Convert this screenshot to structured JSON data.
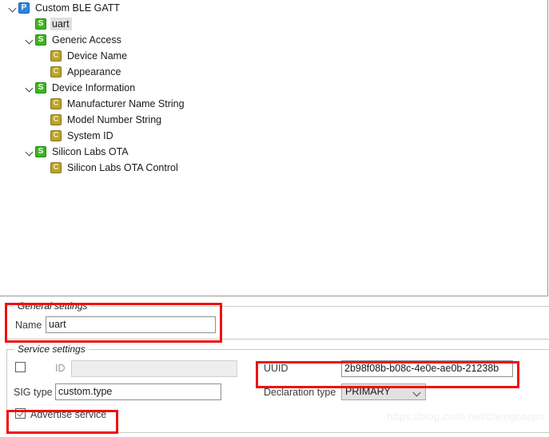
{
  "tree": {
    "name": "gatt-tree",
    "nodes": [
      {
        "label": "Custom BLE GATT",
        "icon": "P",
        "depth": 0,
        "twisty": "open",
        "selected": false
      },
      {
        "label": "uart",
        "icon": "S",
        "depth": 1,
        "twisty": "none",
        "selected": true
      },
      {
        "label": "Generic Access",
        "icon": "S",
        "depth": 1,
        "twisty": "open",
        "selected": false
      },
      {
        "label": "Device Name",
        "icon": "C",
        "depth": 2,
        "twisty": "none",
        "selected": false
      },
      {
        "label": "Appearance",
        "icon": "C",
        "depth": 2,
        "twisty": "none",
        "selected": false
      },
      {
        "label": "Device Information",
        "icon": "S",
        "depth": 1,
        "twisty": "open",
        "selected": false
      },
      {
        "label": "Manufacturer Name String",
        "icon": "C",
        "depth": 2,
        "twisty": "none",
        "selected": false
      },
      {
        "label": "Model Number String",
        "icon": "C",
        "depth": 2,
        "twisty": "none",
        "selected": false
      },
      {
        "label": "System ID",
        "icon": "C",
        "depth": 2,
        "twisty": "none",
        "selected": false
      },
      {
        "label": "Silicon Labs OTA",
        "icon": "S",
        "depth": 1,
        "twisty": "open",
        "selected": false
      },
      {
        "label": "Silicon Labs OTA Control",
        "icon": "C",
        "depth": 2,
        "twisty": "none",
        "selected": false
      }
    ]
  },
  "general_settings": {
    "title": "General settings",
    "name_label": "Name",
    "name_value": "uart"
  },
  "service_settings": {
    "title": "Service settings",
    "id_label": "ID",
    "id_value": "",
    "id_checkbox_checked": false,
    "sig_type_label": "SIG type",
    "sig_type_value": "custom.type",
    "advertise_label": "Advertise service",
    "advertise_checked": true,
    "uuid_label": "UUID",
    "uuid_value": "2b98f08b-b08c-4e0e-ae0b-21238b",
    "declaration_type_label": "Declaration type",
    "declaration_type_value": "PRIMARY"
  },
  "annotations": {
    "color": "#ee1111",
    "boxes": [
      "general-settings-highlight",
      "uuid-highlight",
      "advertise-service-highlight"
    ]
  },
  "watermark": {
    "text": "https://blog.csdn.net/chengbaojin"
  },
  "icons": {
    "P": "profile-icon",
    "S": "service-icon",
    "C": "characteristic-icon"
  }
}
